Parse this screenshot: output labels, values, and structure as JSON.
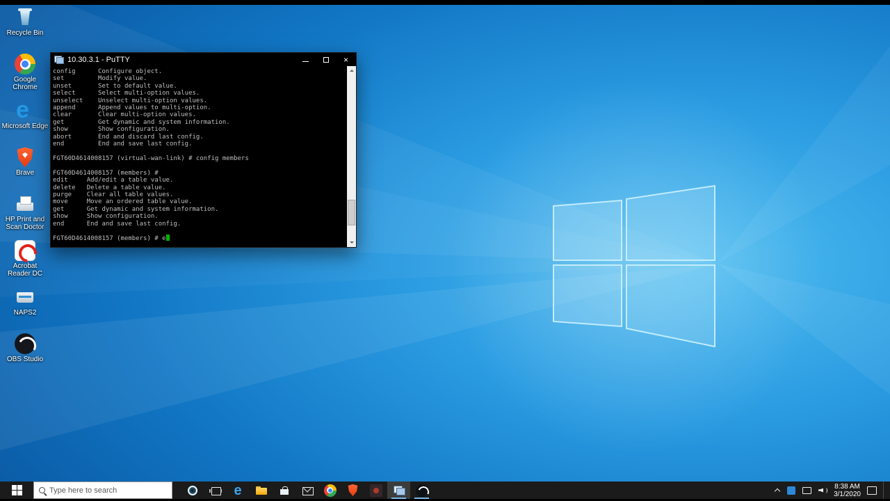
{
  "desktop": {
    "icons": [
      {
        "id": "recycle-bin",
        "label": "Recycle Bin"
      },
      {
        "id": "google-chrome",
        "label": "Google Chrome"
      },
      {
        "id": "microsoft-edge",
        "label": "Microsoft Edge"
      },
      {
        "id": "brave",
        "label": "Brave"
      },
      {
        "id": "hp-print-scan-doctor",
        "label": "HP Print and Scan Doctor"
      },
      {
        "id": "acrobat-reader-dc",
        "label": "Acrobat Reader DC"
      },
      {
        "id": "naps2",
        "label": "NAPS2"
      },
      {
        "id": "obs-studio",
        "label": "OBS Studio"
      }
    ],
    "wallpaper": {
      "base_color": "#0f6ab4",
      "glow_color": "#4fbdf0",
      "logo_edge_color": "#cdf1ff"
    }
  },
  "putty_window": {
    "title": "10.30.3.1 - PuTTY",
    "terminal": {
      "lines": [
        "config      Configure object.",
        "set         Modify value.",
        "unset       Set to default value.",
        "select      Select multi-option values.",
        "unselect    Unselect multi-option values.",
        "append      Append values to multi-option.",
        "clear       Clear multi-option values.",
        "get         Get dynamic and system information.",
        "show        Show configuration.",
        "abort       End and discard last config.",
        "end         End and save last config.",
        "",
        "FGT60D4614008157 (virtual-wan-link) # config members",
        "",
        "FGT60D4614008157 (members) # ",
        "edit     Add/edit a table value.",
        "delete   Delete a table value.",
        "purge    Clear all table values.",
        "move     Move an ordered table value.",
        "get      Get dynamic and system information.",
        "show     Show configuration.",
        "end      End and save last config.",
        ""
      ],
      "prompt": "FGT60D4614008157 (members) # e",
      "text_color": "#bfbfbf",
      "background": "#000000",
      "cursor_color": "#00b400"
    }
  },
  "taskbar": {
    "search_placeholder": "Type here to search",
    "apps": [
      {
        "id": "cortana"
      },
      {
        "id": "task-view"
      },
      {
        "id": "edge"
      },
      {
        "id": "file-explorer"
      },
      {
        "id": "store"
      },
      {
        "id": "mail"
      },
      {
        "id": "chrome"
      },
      {
        "id": "brave"
      },
      {
        "id": "dark-app"
      },
      {
        "id": "putty",
        "active": true
      },
      {
        "id": "obs",
        "running": true
      }
    ],
    "tray": {
      "time": "8:38 AM",
      "date": "3/1/2020"
    }
  }
}
